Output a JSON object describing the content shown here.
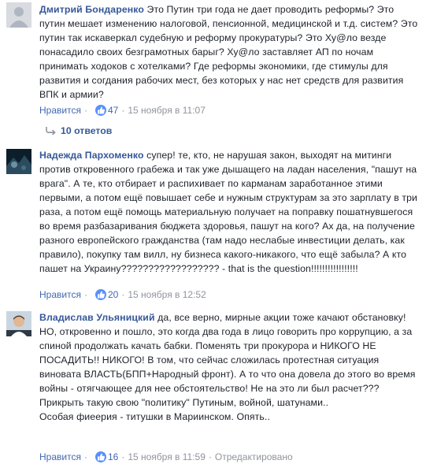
{
  "comments": [
    {
      "author": "Дмитрий Бондаренко",
      "text": "Это Путин три года не дает проводить реформы? Это путин мешает изменению налоговой, пенсионной, медицинской и т.д. систем? Это путин так искаверкал судебную и реформу прокуратуры? Это Ху@ло везде понасадило своих безграмотных барыг? Ху@ло заставляет АП по ночам принимать ходоков с хотелками? Где реформы экономики, где стимулы для развития и согдания рабочих мест, без которых у нас нет средств для развития ВПК и армии?",
      "like_label": "Нравится",
      "reactions": "47",
      "date": "15 ноября в 11:07",
      "replies": "10 ответов"
    },
    {
      "author": "Надежда Пархоменко",
      "text": "супер! те, кто, не нарушая закон, выходят на митинги против откровенного грабежа и так уже дышащего на ладан населения, \"пашут на врага\". А те, кто отбирает и распихивает по карманам заработанное этими первыми, а потом ещё повышает себе и нужным структурам за это зарплату в три раза, а потом ещё помощь материальную получает на поправку пошатнувшегося во время разбазаривания бюджета здоровья, пашут на кого? Ах да, на получение разного европейского гражданства (там надо неслабые инвестиции делать, как правило), покупку там вилл, ну бизнеса какого-никакого, что ещё забыла? А кто пашет на Украину?????????????????? - that is the question!!!!!!!!!!!!!!!!!",
      "like_label": "Нравится",
      "reactions": "20",
      "date": "15 ноября в 12:52"
    },
    {
      "author": "Владислав Ульяницкий",
      "text": "да, все верно, мирные акции тоже качают обстановку!",
      "text2": "НО, откровенно и пошло, это когда два года в лицо говорить про коррупцию, а за спиной продолжать качать бабки. Поменять три прокурора и НИКОГО НЕ ПОСАДИТЬ!! НИКОГО! В том, что сейчас сложилась протестная ситуация виновата ВЛАСТЬ(БПП+Народный фронт). А то что она довела до этого во время войны - отягчающее для нее обстоятельство! Не на это ли был расчет??? Прикрыть такую свою \"политику\" Путиным, войной, шатунами..",
      "text3": "Особая фиеерия - титушки в Мариинском. Опять..",
      "like_label": "Нравится",
      "reactions": "16",
      "date": "15 ноября в 11:59",
      "edited": "Отредактировано"
    }
  ],
  "colors": {
    "link": "#365899",
    "meta": "#90949c",
    "like_badge": "#5890ff"
  }
}
